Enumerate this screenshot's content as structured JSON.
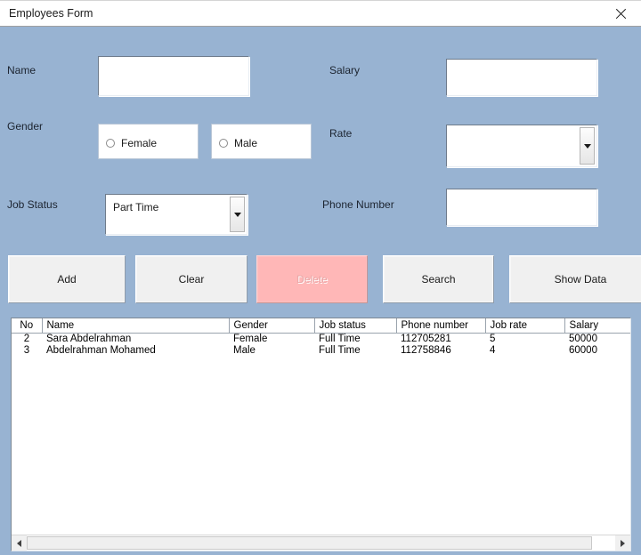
{
  "window": {
    "title": "Employees Form",
    "close_icon": "close-icon",
    "background_color": "#98b3d2",
    "titlebar_color": "#ffffff"
  },
  "form": {
    "labels": {
      "name": "Name",
      "gender": "Gender",
      "job_status": "Job Status",
      "salary": "Salary",
      "rate": "Rate",
      "phone_number": "Phone Number"
    },
    "fields": {
      "name_value": "",
      "salary_value": "",
      "phone_value": "",
      "job_status_value": "Part Time",
      "rate_value": ""
    },
    "gender": {
      "female_label": "Female",
      "male_label": "Male",
      "female_selected": false,
      "male_selected": false
    }
  },
  "buttons": [
    {
      "label": "Add",
      "name": "add-button",
      "state": "enabled"
    },
    {
      "label": "Clear",
      "name": "clear-button",
      "state": "enabled"
    },
    {
      "label": "Delete",
      "name": "delete-button",
      "state": "disabled",
      "color": "#ffb7b7"
    },
    {
      "label": "Search",
      "name": "search-button",
      "state": "enabled"
    },
    {
      "label": "Show Data",
      "name": "show-data-button",
      "state": "enabled"
    }
  ],
  "grid": {
    "columns": [
      "No",
      "Name",
      "Gender",
      "Job status",
      "Phone number",
      "Job rate",
      "Salary"
    ],
    "rows": [
      {
        "no": "2",
        "name": "Sara  Abdelrahman",
        "gender": "Female",
        "job_status": "Full Time",
        "phone_number": "112705281",
        "job_rate": "5",
        "salary": "50000"
      },
      {
        "no": "3",
        "name": "Abdelrahman Mohamed",
        "gender": "Male",
        "job_status": "Full Time",
        "phone_number": "112758846",
        "job_rate": "4",
        "salary": "60000"
      }
    ],
    "scrollbar": {
      "left_arrow_icon": "caret-left-icon",
      "right_arrow_icon": "caret-right-icon",
      "thumb_position_percent": 0,
      "thumb_width_percent": 96
    }
  }
}
